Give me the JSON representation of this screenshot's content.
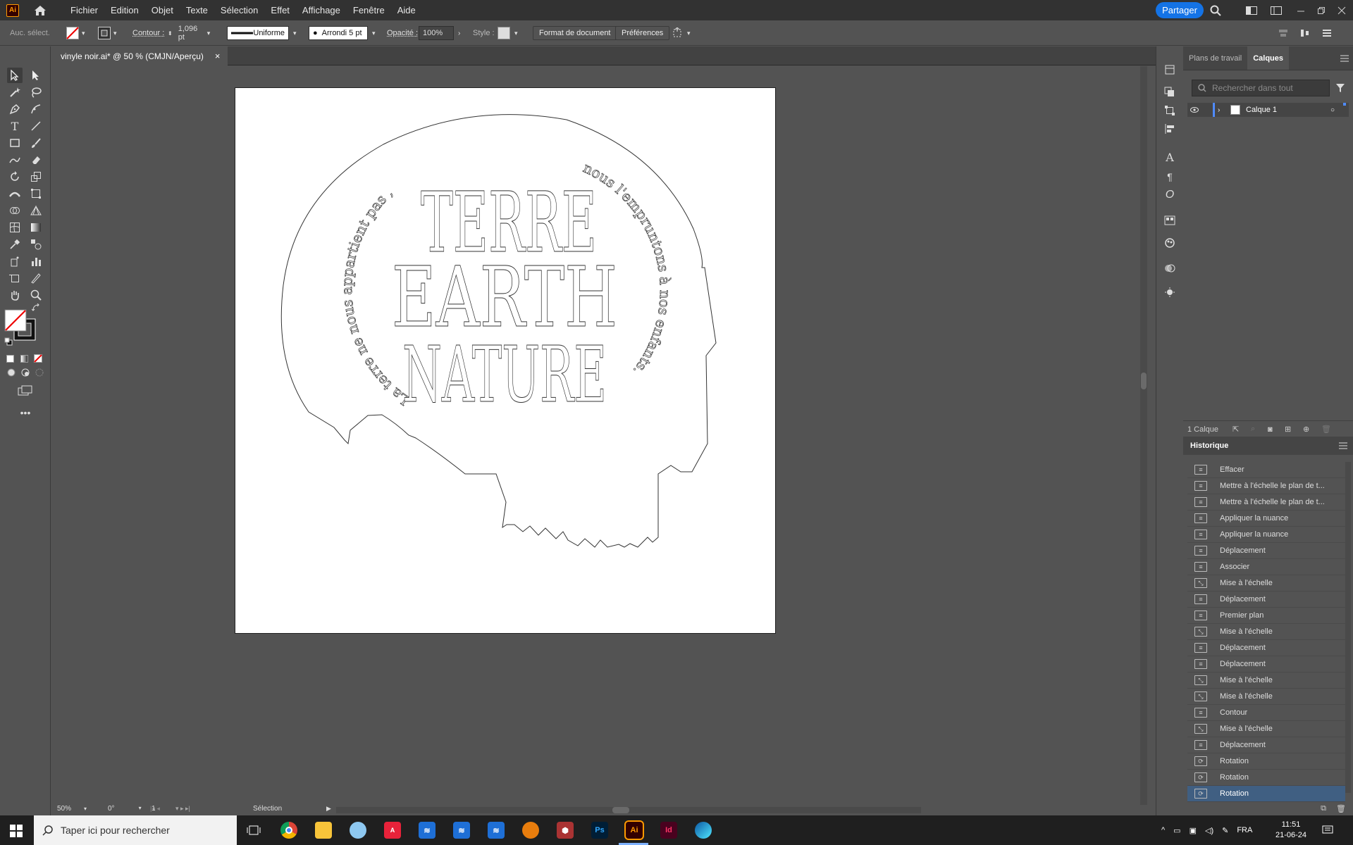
{
  "menubar": {
    "logo": "Ai",
    "items": [
      "Fichier",
      "Edition",
      "Objet",
      "Texte",
      "Sélection",
      "Effet",
      "Affichage",
      "Fenêtre",
      "Aide"
    ],
    "share_label": "Partager"
  },
  "controlbar": {
    "selection_status": "Auc. sélect.",
    "contour_label": "Contour :",
    "stroke_weight": "1,096 pt",
    "stroke_profile": "Uniforme",
    "brush": "Arrondi 5 pt",
    "opacity_label": "Opacité :",
    "opacity_value": "100%",
    "style_label": "Style :",
    "doc_format_button": "Format de document",
    "preferences_button": "Préférences"
  },
  "document": {
    "tab_title": "vinyle noir.ai* @ 50 % (CMJN/Aperçu)"
  },
  "artwork": {
    "word1": "TERRE",
    "word2": "EARTH",
    "word3": "NATURE",
    "circle_text_left": "La terre ne nous appartient pas ,",
    "circle_text_right": "nous l'empruntons à nos enfants."
  },
  "layers_panel": {
    "tabs": [
      "Plans de travail",
      "Calques"
    ],
    "active_tab": "Calques",
    "search_placeholder": "Rechercher dans tout",
    "layers": [
      {
        "name": "Calque 1"
      }
    ],
    "count_label": "1 Calque"
  },
  "history_panel": {
    "title": "Historique",
    "items": [
      {
        "label": "Effacer",
        "icon": "doc"
      },
      {
        "label": "Mettre à l'échelle le plan de t...",
        "icon": "doc"
      },
      {
        "label": "Mettre à l'échelle le plan de t...",
        "icon": "doc"
      },
      {
        "label": "Appliquer la nuance",
        "icon": "doc"
      },
      {
        "label": "Appliquer la nuance",
        "icon": "doc"
      },
      {
        "label": "Déplacement",
        "icon": "doc"
      },
      {
        "label": "Associer",
        "icon": "doc"
      },
      {
        "label": "Mise à l'échelle",
        "icon": "scale"
      },
      {
        "label": "Déplacement",
        "icon": "doc"
      },
      {
        "label": "Premier plan",
        "icon": "doc"
      },
      {
        "label": "Mise à l'échelle",
        "icon": "scale"
      },
      {
        "label": "Déplacement",
        "icon": "doc"
      },
      {
        "label": "Déplacement",
        "icon": "doc"
      },
      {
        "label": "Mise à l'échelle",
        "icon": "scale"
      },
      {
        "label": "Mise à l'échelle",
        "icon": "scale"
      },
      {
        "label": "Contour",
        "icon": "doc"
      },
      {
        "label": "Mise à l'échelle",
        "icon": "scale"
      },
      {
        "label": "Déplacement",
        "icon": "doc"
      },
      {
        "label": "Rotation",
        "icon": "rotate"
      },
      {
        "label": "Rotation",
        "icon": "rotate"
      },
      {
        "label": "Rotation",
        "icon": "rotate"
      }
    ]
  },
  "statusbar": {
    "zoom": "50%",
    "rotation": "0°",
    "artboard_num": "1",
    "tool": "Sélection"
  },
  "taskbar": {
    "search_placeholder": "Taper ici pour rechercher",
    "lang": "FRA",
    "time": "11:51",
    "date": "21-06-24"
  },
  "colors": {
    "accent": "#1473e6",
    "panel_bg": "#535353",
    "selection": "#405f82",
    "illustrator_orange": "#ff9a00"
  }
}
